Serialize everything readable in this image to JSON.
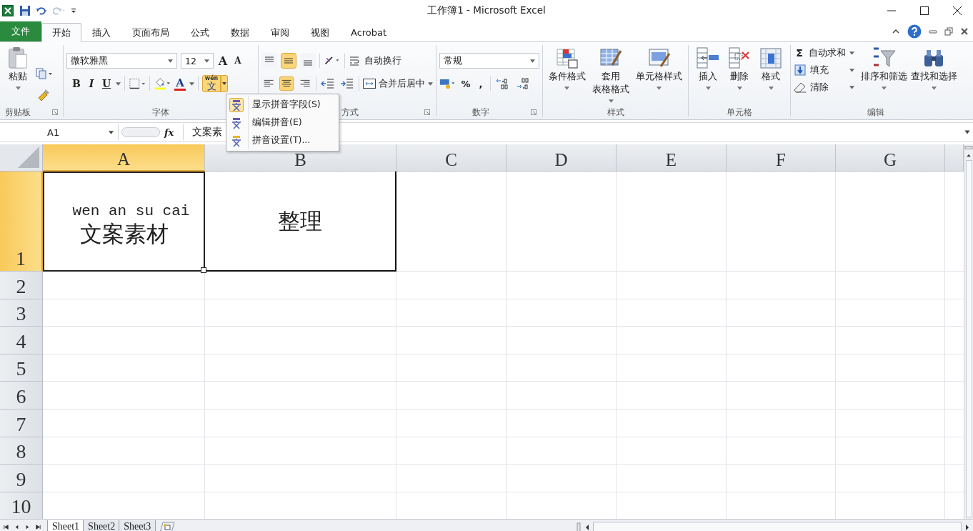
{
  "window": {
    "title": "工作簿1 - Microsoft Excel"
  },
  "tabs": [
    {
      "label": "文件",
      "kind": "file",
      "selected": false
    },
    {
      "label": "开始",
      "kind": "tab",
      "selected": true
    },
    {
      "label": "插入",
      "kind": "tab",
      "selected": false
    },
    {
      "label": "页面布局",
      "kind": "tab",
      "selected": false
    },
    {
      "label": "公式",
      "kind": "tab",
      "selected": false
    },
    {
      "label": "数据",
      "kind": "tab",
      "selected": false
    },
    {
      "label": "审阅",
      "kind": "tab",
      "selected": false
    },
    {
      "label": "视图",
      "kind": "tab",
      "selected": false
    },
    {
      "label": "Acrobat",
      "kind": "tab",
      "selected": false
    }
  ],
  "ribbon": {
    "clipboard": {
      "label": "剪贴板",
      "paste": "粘贴"
    },
    "font": {
      "label": "字体",
      "font_name": "微软雅黑",
      "font_size": "12",
      "grow": "A",
      "shrink": "A",
      "bold": "B",
      "italic": "I",
      "underline": "U",
      "font_color": "A",
      "phonetic_pinyin": "wén",
      "phonetic_char": "文",
      "phonetic_open": true
    },
    "alignment": {
      "label": "方式",
      "wrap": "自动换行",
      "merge": "合并后居中",
      "vertical": [
        {
          "selected": false
        },
        {
          "selected": true
        },
        {
          "selected": false
        }
      ],
      "horizontal": [
        {
          "selected": false
        },
        {
          "selected": true
        },
        {
          "selected": false
        }
      ]
    },
    "number": {
      "label": "数字",
      "format": "常规",
      "percent": "%",
      "comma": ","
    },
    "styles": {
      "label": "样式",
      "items": [
        {
          "lines": [
            "条件格式"
          ]
        },
        {
          "lines": [
            "套用",
            "表格格式"
          ]
        },
        {
          "lines": [
            "单元格样式"
          ]
        }
      ]
    },
    "cells": {
      "label": "单元格",
      "items": [
        "插入",
        "删除",
        "格式"
      ]
    },
    "editing": {
      "label": "编辑",
      "sum_sign": "Σ",
      "small": [
        "自动求和",
        "填充",
        "清除"
      ],
      "large": [
        "排序和筛选",
        "查找和选择"
      ]
    }
  },
  "formula_bar": {
    "name_box": "A1",
    "fx": "fx",
    "value": "文案素"
  },
  "menu": {
    "items": [
      {
        "label": "显示拼音字段(S)"
      },
      {
        "label": "编辑拼音(E)"
      },
      {
        "label": "拼音设置(T)..."
      }
    ]
  },
  "sheet": {
    "columns": [
      {
        "label": "A",
        "selected": true
      },
      {
        "label": "B",
        "selected": false
      },
      {
        "label": "C",
        "selected": false
      },
      {
        "label": "D",
        "selected": false
      },
      {
        "label": "E",
        "selected": false
      },
      {
        "label": "F",
        "selected": false
      },
      {
        "label": "G",
        "selected": false
      }
    ],
    "rows": [
      {
        "label": "1",
        "selected": true
      },
      {
        "label": "2",
        "selected": false
      },
      {
        "label": "3",
        "selected": false
      },
      {
        "label": "4",
        "selected": false
      },
      {
        "label": "5",
        "selected": false
      },
      {
        "label": "6",
        "selected": false
      },
      {
        "label": "7",
        "selected": false
      },
      {
        "label": "8",
        "selected": false
      },
      {
        "label": "9",
        "selected": false
      },
      {
        "label": "10",
        "selected": false
      }
    ],
    "a1": {
      "phonetic": "wen an su cai",
      "text": "文案素材"
    },
    "b1": {
      "text": "整理"
    }
  },
  "sheet_tabs": [
    {
      "label": "Sheet1",
      "selected": true
    },
    {
      "label": "Sheet2",
      "selected": false
    },
    {
      "label": "Sheet3",
      "selected": false
    }
  ]
}
